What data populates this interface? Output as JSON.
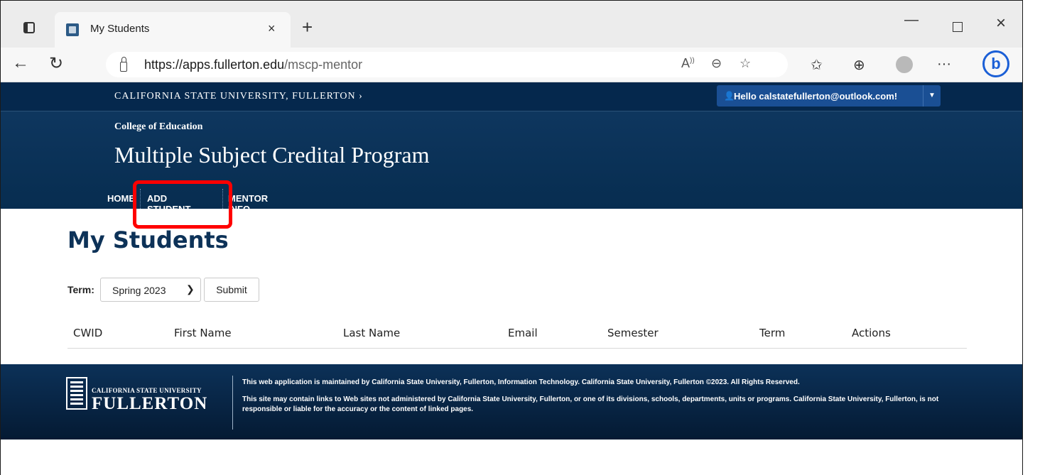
{
  "browser": {
    "tab_title": "My Students",
    "tab_close": "×",
    "new_tab": "+",
    "url_host": "https://apps.fullerton.edu",
    "url_path": "/mscp-mentor",
    "win_min": "—",
    "win_close": "×",
    "more": "···",
    "bing": "b"
  },
  "site": {
    "university_link": "CALIFORNIA STATE UNIVERSITY, FULLERTON ›",
    "user_greeting": "Hello calstatefullerton@outlook.com!",
    "college": "College of Education",
    "program": "Multiple Subject Credital Program",
    "nav": [
      "HOME",
      "ADD STUDENT",
      "MENTOR INFO"
    ]
  },
  "main": {
    "title": "My Students",
    "term_label": "Term:",
    "term_value": "Spring 2023",
    "submit": "Submit",
    "columns": [
      "CWID",
      "First Name",
      "Last Name",
      "Email",
      "Semester",
      "Term",
      "Actions"
    ]
  },
  "footer": {
    "logo_top": "CALIFORNIA STATE UNIVERSITY",
    "logo_bottom": "FULLERTON",
    "line1": "This web application is maintained by California State University, Fullerton, Information Technology. California State University, Fullerton ©2023. All Rights Reserved.",
    "line2": "This site may contain links to Web sites not administered by California State University, Fullerton, or one of its divisions, schools, departments, units or programs. California State University, Fullerton, is not responsible or liable for the accuracy or the content of linked pages."
  },
  "colors": {
    "header_navy": "#072d50",
    "highlight_red": "#ff0000",
    "title_blue": "#0d3258"
  }
}
